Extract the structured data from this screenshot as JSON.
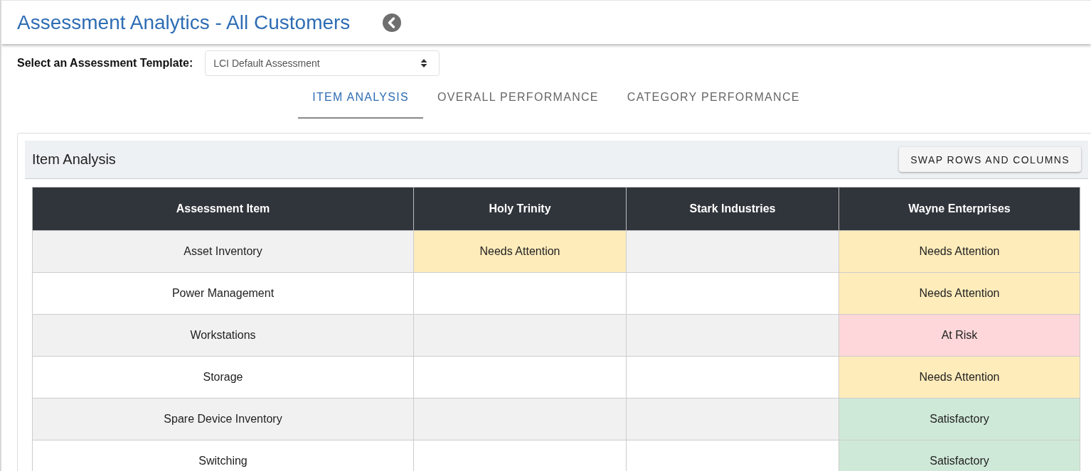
{
  "page_title": "Assessment Analytics - All Customers",
  "template_select": {
    "label": "Select an Assessment Template:",
    "value": "LCI Default Assessment"
  },
  "tabs": [
    {
      "label": "ITEM ANALYSIS",
      "selected": true
    },
    {
      "label": "OVERALL PERFORMANCE",
      "selected": false
    },
    {
      "label": "CATEGORY PERFORMANCE",
      "selected": false
    }
  ],
  "panel": {
    "title": "Item Analysis",
    "button": "SWAP ROWS AND COLUMNS"
  },
  "table": {
    "columns": [
      "Assessment Item",
      "Holy Trinity",
      "Stark Industries",
      "Wayne Enterprises"
    ],
    "rows": [
      {
        "cells": [
          {
            "kind": "item",
            "text": "Asset Inventory"
          },
          {
            "kind": "needs-attention",
            "text": "Needs Attention"
          },
          {
            "kind": "empty",
            "text": ""
          },
          {
            "kind": "needs-attention",
            "text": "Needs Attention"
          }
        ]
      },
      {
        "cells": [
          {
            "kind": "item",
            "text": "Power Management"
          },
          {
            "kind": "empty",
            "text": ""
          },
          {
            "kind": "empty",
            "text": ""
          },
          {
            "kind": "needs-attention",
            "text": "Needs Attention"
          }
        ]
      },
      {
        "cells": [
          {
            "kind": "item",
            "text": "Workstations"
          },
          {
            "kind": "empty",
            "text": ""
          },
          {
            "kind": "empty",
            "text": ""
          },
          {
            "kind": "at-risk",
            "text": "At Risk"
          }
        ]
      },
      {
        "cells": [
          {
            "kind": "item",
            "text": "Storage"
          },
          {
            "kind": "empty",
            "text": ""
          },
          {
            "kind": "empty",
            "text": ""
          },
          {
            "kind": "needs-attention",
            "text": "Needs Attention"
          }
        ]
      },
      {
        "cells": [
          {
            "kind": "item",
            "text": "Spare Device Inventory"
          },
          {
            "kind": "empty",
            "text": ""
          },
          {
            "kind": "empty",
            "text": ""
          },
          {
            "kind": "satisfactory",
            "text": "Satisfactory"
          }
        ]
      },
      {
        "cells": [
          {
            "kind": "item",
            "text": "Switching"
          },
          {
            "kind": "empty",
            "text": ""
          },
          {
            "kind": "empty",
            "text": ""
          },
          {
            "kind": "satisfactory",
            "text": "Satisfactory"
          }
        ]
      }
    ]
  }
}
